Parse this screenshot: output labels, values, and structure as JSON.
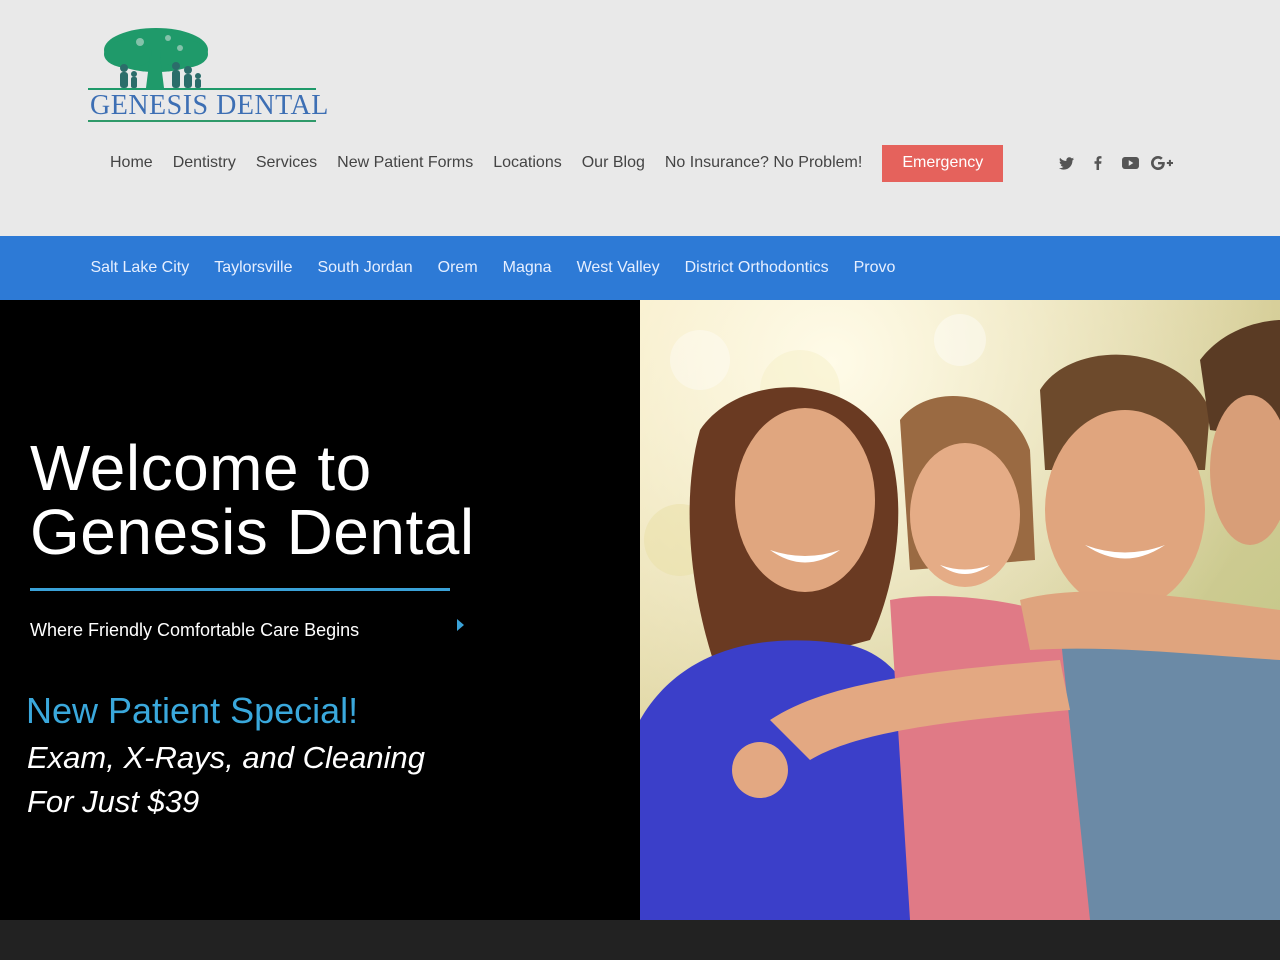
{
  "brand": {
    "name": "GENESIS DENTAL",
    "primary_color": "#2d7ad6",
    "logo_green": "#1f9a6a"
  },
  "main_nav": {
    "items": [
      "Home",
      "Dentistry",
      "Services",
      "New Patient Forms",
      "Locations",
      "Our Blog",
      "No Insurance? No Problem!"
    ],
    "emergency_label": "Emergency",
    "emergency_color": "#e5625c"
  },
  "social": [
    "twitter-icon",
    "facebook-icon",
    "youtube-icon",
    "google-plus-icon"
  ],
  "locations": [
    "Salt Lake City",
    "Taylorsville",
    "South Jordan",
    "Orem",
    "Magna",
    "West Valley",
    "District Orthodontics",
    "Provo"
  ],
  "hero": {
    "title_line1": "Welcome to",
    "title_line2": "Genesis Dental",
    "subtitle": "Where Friendly Comfortable Care Begins",
    "special_title": "New Patient Special!",
    "special_line1": "Exam, X-Rays, and Cleaning",
    "special_line2": "For Just $39"
  }
}
